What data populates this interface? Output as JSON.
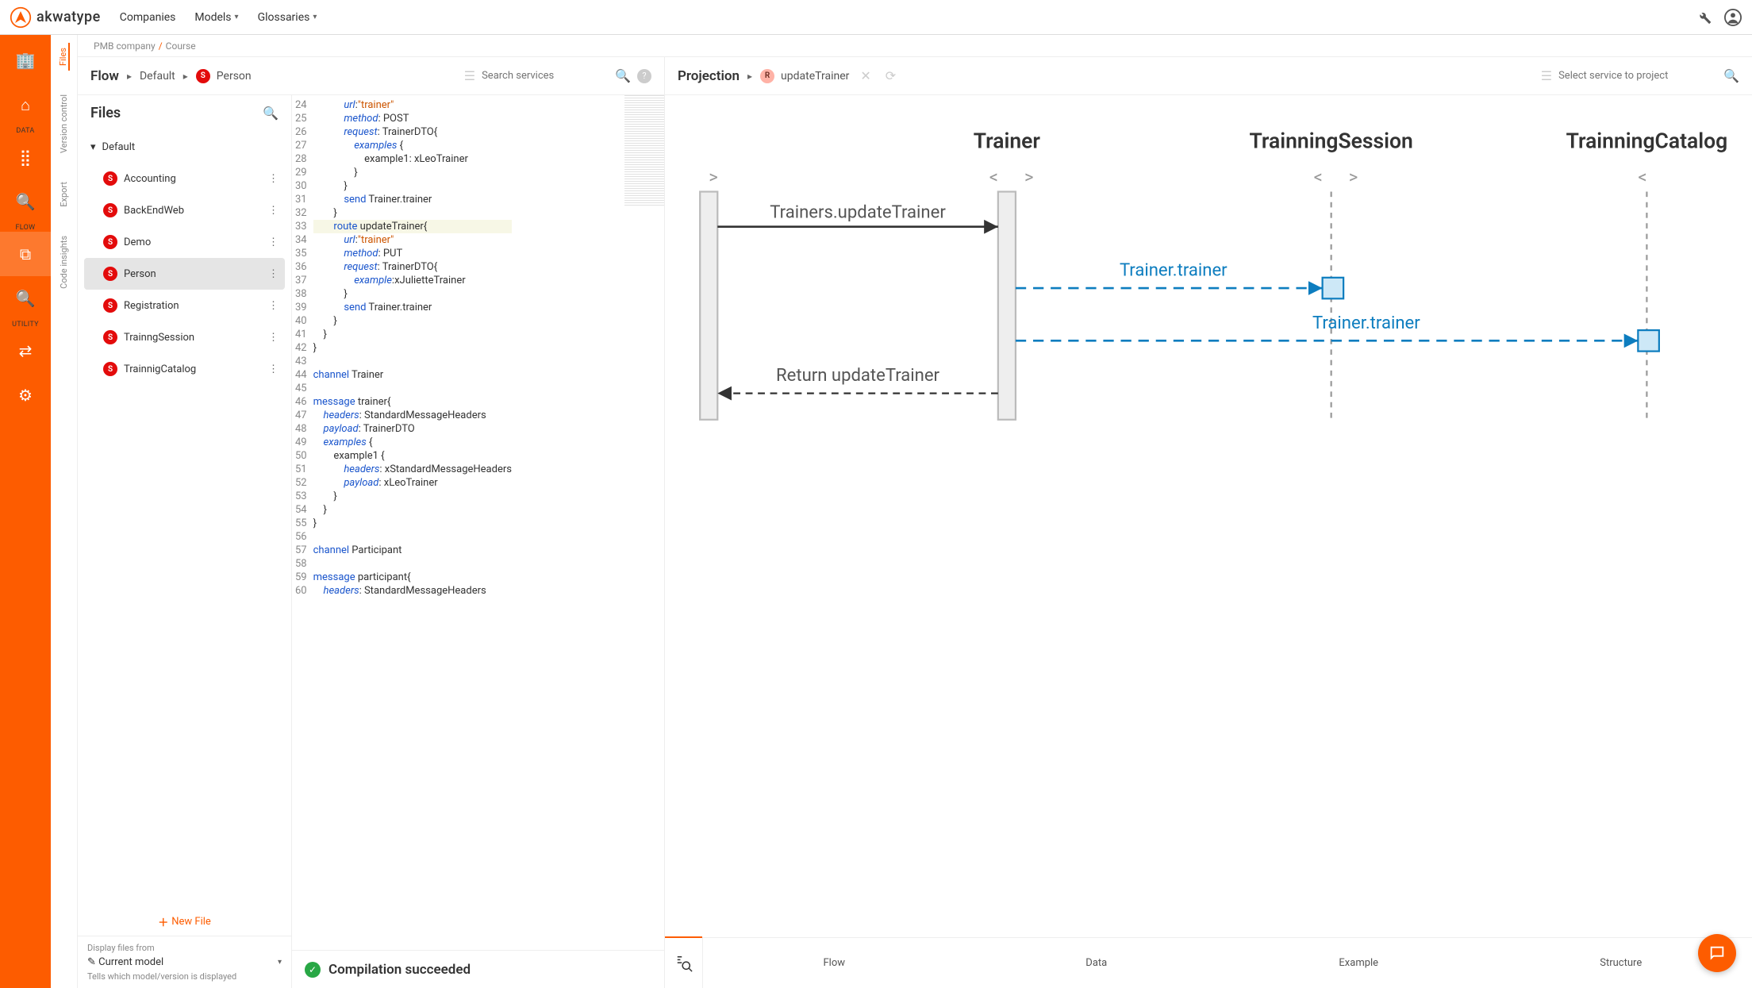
{
  "brand": {
    "name": "akwatype"
  },
  "topnav": {
    "companies": "Companies",
    "models": "Models",
    "glossaries": "Glossaries"
  },
  "breadcrumb": {
    "company": "PMB company",
    "model": "Course"
  },
  "flowHeader": {
    "title": "Flow",
    "path1": "Default",
    "path2": "Person",
    "searchPlaceholder": "Search services"
  },
  "projectionHeader": {
    "title": "Projection",
    "item": "updateTrainer",
    "searchPlaceholder": "Select service to project"
  },
  "sidebar": {
    "data": "DATA",
    "flow": "FLOW",
    "utility": "UTILITY"
  },
  "vtabs": {
    "files": "Files",
    "version": "Version control",
    "export": "Export",
    "insights": "Code insights"
  },
  "files": {
    "title": "Files",
    "group": "Default",
    "items": [
      "Accounting",
      "BackEndWeb",
      "Demo",
      "Person",
      "Registration",
      "TrainngSession",
      "TrainnigCatalog"
    ],
    "selected": "Person",
    "newFile": "New File",
    "footLabel": "Display files from",
    "footModel": "Current model",
    "footHint": "Tells which model/version is displayed"
  },
  "editor": {
    "startLine": 24,
    "lines": [
      "            url:\"trainer\"",
      "            method: POST",
      "            request: TrainerDTO{",
      "                examples {",
      "                    example1: xLeoTrainer",
      "                }",
      "            }",
      "            send Trainer.trainer",
      "        }",
      "        route updateTrainer{",
      "            url:\"trainer\"",
      "            method: PUT",
      "            request: TrainerDTO{",
      "                example:xJulietteTrainer",
      "            }",
      "            send Trainer.trainer",
      "        }",
      "    }",
      "}",
      "",
      "channel Trainer",
      "",
      "message trainer{",
      "    headers: StandardMessageHeaders",
      "    payload: TrainerDTO",
      "    examples {",
      "        example1 {",
      "            headers: xStandardMessageHeaders",
      "            payload: xLeoTrainer",
      "        }",
      "    }",
      "}",
      "",
      "channel Participant",
      "",
      "message participant{",
      "    headers: StandardMessageHeaders"
    ],
    "highlightLine": 33
  },
  "status": {
    "text": "Compilation succeeded"
  },
  "diagram": {
    "lanes": [
      "Trainer",
      "TrainningSession",
      "TrainningCatalog"
    ],
    "messages": {
      "call": "Trainers.updateTrainer",
      "send1": "Trainer.trainer",
      "send2": "Trainer.trainer",
      "ret": "Return updateTrainer"
    }
  },
  "projTabs": [
    "Flow",
    "Data",
    "Example",
    "Structure"
  ]
}
